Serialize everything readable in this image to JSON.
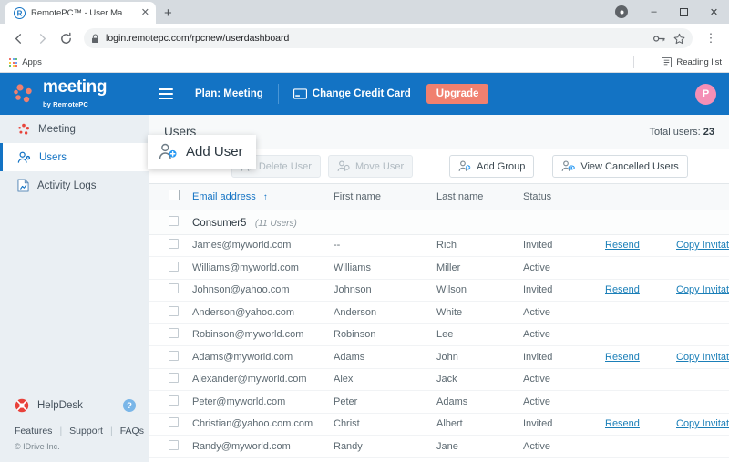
{
  "browser": {
    "tab": {
      "title": "RemotePC™ - User Management",
      "favicon": "remotepc-r-icon",
      "close": "✕"
    },
    "new_tab_label": "+",
    "window_controls": {
      "minimize": "–",
      "maximize": "❐",
      "close": "✕"
    },
    "nav": {
      "back": "←",
      "forward": "→",
      "reload": "⟳"
    },
    "omnibox": {
      "url": "login.remotepc.com/rpcnew/userdashboard",
      "lock": "lock-icon",
      "key": "key-icon",
      "star": "star-icon",
      "menu": "⋮"
    },
    "bookmarks": {
      "apps_label": "Apps",
      "reading_list_label": "Reading list"
    }
  },
  "header": {
    "logo_main": "meeting",
    "logo_sub": "by RemotePC",
    "plan_label": "Plan: Meeting",
    "change_card_label": "Change Credit Card",
    "upgrade_label": "Upgrade",
    "avatar_initial": "P",
    "accent_blue": "#1373c4",
    "upgrade_color": "#f0806f",
    "avatar_color": "#f48fb6"
  },
  "sidebar": {
    "items": [
      {
        "label": "Meeting",
        "icon": "meeting-dots-icon",
        "active": false
      },
      {
        "label": "Users",
        "icon": "user-gear-icon",
        "active": true
      },
      {
        "label": "Activity Logs",
        "icon": "document-chart-icon",
        "active": false
      }
    ],
    "helpdesk_label": "HelpDesk",
    "help_badge": "?",
    "links": [
      "Features",
      "Support",
      "FAQs"
    ],
    "copyright": "© IDrive Inc."
  },
  "main": {
    "title": "Users",
    "total_users_label": "Total users:",
    "total_users_count": "23",
    "toolbar": {
      "add_user": "Add User",
      "delete_user": "Delete User",
      "move_user": "Move User",
      "add_group": "Add Group",
      "view_cancelled": "View Cancelled Users"
    },
    "table": {
      "columns": [
        "Email address",
        "First name",
        "Last name",
        "Status"
      ],
      "sort_column": "Email address",
      "sort_direction": "↑",
      "export_icon": "export-upload-icon",
      "group": {
        "name": "Consumer5",
        "count": "(11 Users)",
        "collapse_icon": "˄"
      },
      "action_labels": {
        "resend": "Resend",
        "copy_invitation": "Copy Invitation"
      },
      "rows": [
        {
          "email": "James@myworld.com",
          "first": "--",
          "last": "Rich",
          "status": "Invited",
          "actions": true
        },
        {
          "email": "Williams@myworld.com",
          "first": "Williams",
          "last": "Miller",
          "status": "Active",
          "actions": false
        },
        {
          "email": "Johnson@yahoo.com",
          "first": "Johnson",
          "last": "Wilson",
          "status": "Invited",
          "actions": true
        },
        {
          "email": "Anderson@yahoo.com",
          "first": "Anderson",
          "last": "White",
          "status": "Active",
          "actions": false
        },
        {
          "email": "Robinson@myworld.com",
          "first": "Robinson",
          "last": "Lee",
          "status": "Active",
          "actions": false
        },
        {
          "email": "Adams@myworld.com",
          "first": "Adams",
          "last": "John",
          "status": "Invited",
          "actions": true
        },
        {
          "email": "Alexander@myworld.com",
          "first": "Alex",
          "last": "Jack",
          "status": "Active",
          "actions": false
        },
        {
          "email": "Peter@myworld.com",
          "first": "Peter",
          "last": "Adams",
          "status": "Active",
          "actions": false
        },
        {
          "email": "Christian@yahoo.com.com",
          "first": "Christ",
          "last": "Albert",
          "status": "Invited",
          "actions": true
        },
        {
          "email": "Randy@myworld.com",
          "first": "Randy",
          "last": "Jane",
          "status": "Active",
          "actions": false
        }
      ]
    }
  }
}
